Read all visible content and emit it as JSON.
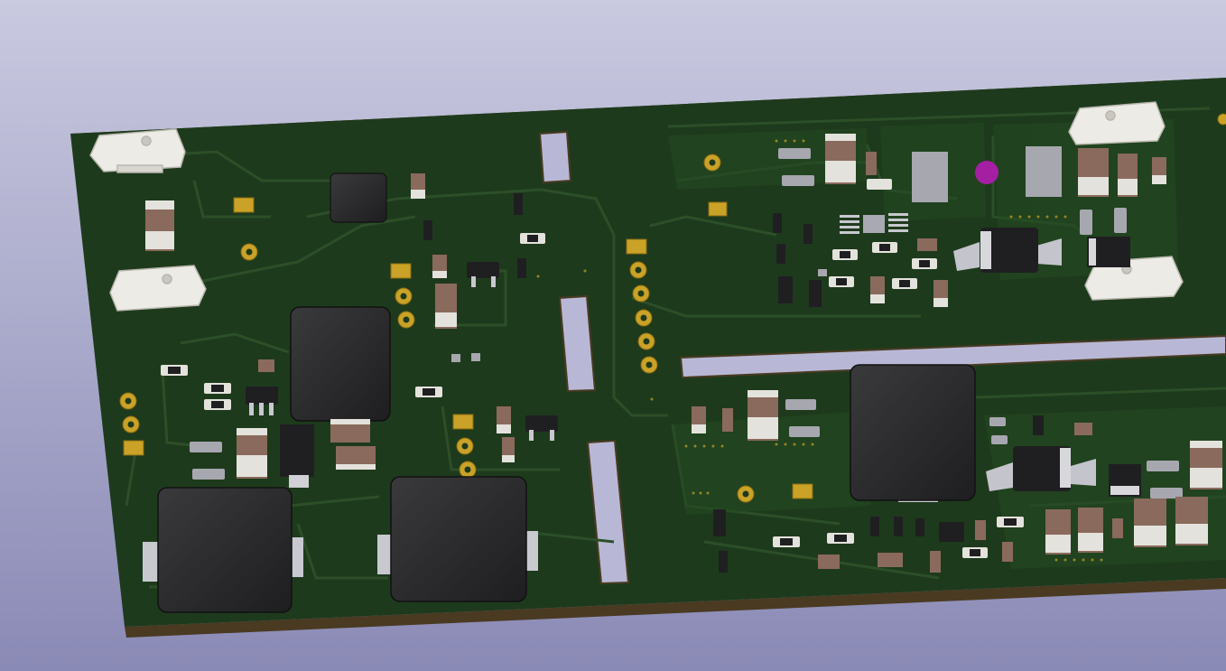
{
  "scene": {
    "viewer": "3D PCB viewer",
    "background_colors": [
      "#c9c9e0",
      "#8a8ab6"
    ],
    "board_color": "#1e3a1c",
    "board_edge_color": "#4a3a22",
    "trace_color": "#2c4f28",
    "pad_color": "#c9a227",
    "inductor_color": "#2b2b2d",
    "capacitor_color": "#8a6a5c",
    "connector_color": "#ecebe6",
    "via_highlight_color": "#a51fa3"
  }
}
